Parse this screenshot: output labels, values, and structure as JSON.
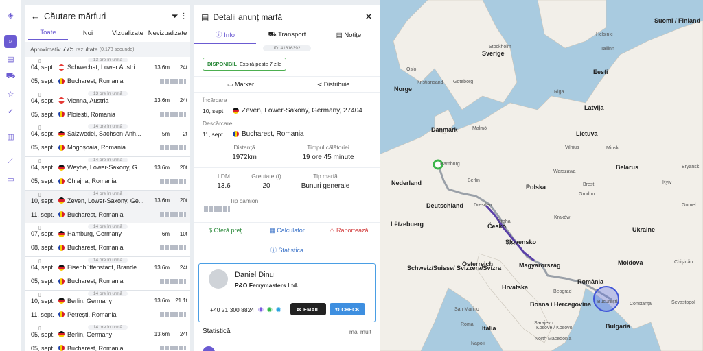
{
  "rail": {
    "items": [
      "logo-icon",
      "search-icon",
      "document-icon",
      "truck-icon",
      "star-icon",
      "check-icon",
      "book-icon",
      "chart-icon",
      "archive-icon"
    ]
  },
  "list": {
    "title": "Căutare mărfuri",
    "tabs": [
      "Toate",
      "Noi",
      "Vizualizate",
      "Nevizualizate"
    ],
    "approx_prefix": "Aproximativ",
    "approx_count": "775",
    "approx_suffix": "rezultate",
    "approx_time": "(0.178 secunde)",
    "cards": [
      {
        "ago": "13 ore în urmă",
        "d1": "04, sept.",
        "from": "Schwechat, Lower Austri...",
        "ldm": "13.6m",
        "w": "24t",
        "d2": "05, sept.",
        "to": "Bucharest, Romania",
        "f1": "at",
        "f2": "ro"
      },
      {
        "ago": "13 ore în urmă",
        "d1": "04, sept.",
        "from": "Vienna, Austria",
        "ldm": "13.6m",
        "w": "24t",
        "d2": "05, sept.",
        "to": "Ploiesti, Romania",
        "f1": "at",
        "f2": "ro"
      },
      {
        "ago": "14 ore în urmă",
        "d1": "04, sept.",
        "from": "Salzwedel, Sachsen-Anh...",
        "ldm": "5m",
        "w": "2t",
        "d2": "05, sept.",
        "to": "Mogoșoaia, Romania",
        "f1": "de",
        "f2": "ro"
      },
      {
        "ago": "14 ore în urmă",
        "d1": "04, sept.",
        "from": "Weyhe, Lower-Saxony, G...",
        "ldm": "13.6m",
        "w": "20t",
        "d2": "05, sept.",
        "to": "Chiajna, Romania",
        "f1": "de",
        "f2": "ro"
      },
      {
        "ago": "14 ore în urmă",
        "d1": "10, sept.",
        "from": "Zeven, Lower-Saxony, Ge...",
        "ldm": "13.6m",
        "w": "20t",
        "d2": "11, sept.",
        "to": "Bucharest, Romania",
        "f1": "de",
        "f2": "ro"
      },
      {
        "ago": "14 ore în urmă",
        "d1": "07, sept.",
        "from": "Hamburg, Germany",
        "ldm": "6m",
        "w": "10t",
        "d2": "08, sept.",
        "to": "Bucharest, Romania",
        "f1": "de",
        "f2": "ro"
      },
      {
        "ago": "14 ore în urmă",
        "d1": "04, sept.",
        "from": "Eisenhüttenstadt, Brande...",
        "ldm": "13.6m",
        "w": "24t",
        "d2": "05, sept.",
        "to": "Bucharest, Romania",
        "f1": "de",
        "f2": "ro"
      },
      {
        "ago": "14 ore în urmă",
        "d1": "10, sept.",
        "from": "Berlin, Germany",
        "ldm": "13.6m",
        "w": "21.1t",
        "d2": "11, sept.",
        "to": "Petrești, Romania",
        "f1": "de",
        "f2": "ro"
      },
      {
        "ago": "14 ore în urmă",
        "d1": "05, sept.",
        "from": "Berlin, Germany",
        "ldm": "13.6m",
        "w": "24t",
        "d2": "05, sept.",
        "to": "Bucharest, Romania",
        "f1": "de",
        "f2": "ro"
      }
    ]
  },
  "detail": {
    "title": "Detalii anunț marfă",
    "tabs": [
      "Info",
      "Transport",
      "Notițe"
    ],
    "id": "ID: 41616392",
    "avail": "DISPONIBIL",
    "expires": "Expiră peste 7 zile",
    "marker": "Marker",
    "share": "Distribuie",
    "load_label": "Încărcare",
    "load_date": "10, sept.",
    "load_place": "Zeven, Lower-Saxony, Germany, 27404",
    "unload_label": "Descărcare",
    "unload_date": "11, sept.",
    "unload_place": "Bucharest, Romania",
    "dist_label": "Distanță",
    "dist": "1972km",
    "time_label": "Timpul călătoriei",
    "time": "19 ore 45 minute",
    "ldm_label": "LDM",
    "ldm": "13.6",
    "wt_label": "Greutate (t)",
    "wt": "20",
    "type_label": "Tip marfă",
    "type": "Bunuri generale",
    "truck_label": "Tip camion",
    "offer": "Oferă preț",
    "calc": "Calculator",
    "report": "Raportează",
    "stats_link": "Statistica",
    "contact": {
      "name": "Daniel Dinu",
      "company": "P&O Ferrymasters Ltd.",
      "phone": "+40 21 300 8824",
      "email": "EMAIL",
      "check": "CHECK"
    },
    "stats_title": "Statistică",
    "more": "mai mult"
  },
  "map": {
    "labels": [
      [
        "Sverige",
        "b"
      ],
      [
        "Suomi / Finland",
        "b"
      ],
      [
        "Norge",
        "b"
      ],
      [
        "Eesti",
        "b"
      ],
      [
        "Latvija",
        "b"
      ],
      [
        "Lietuva",
        "b"
      ],
      [
        "Danmark",
        "b"
      ],
      [
        "Belarus",
        "b"
      ],
      [
        "Polska",
        "b"
      ],
      [
        "Nederland",
        "b"
      ],
      [
        "Deutschland",
        "b"
      ],
      [
        "Česko",
        "b"
      ],
      [
        "Slovensko",
        "b"
      ],
      [
        "Magyarország",
        "b"
      ],
      [
        "România",
        "b"
      ],
      [
        "Moldova",
        "b"
      ],
      [
        "Ukraine",
        "b"
      ],
      [
        "Österreich",
        "b"
      ],
      [
        "Hrvatska",
        "b"
      ],
      [
        "Bulgaria",
        "b"
      ],
      [
        "Italia",
        "b"
      ],
      [
        "Bosna i Hercegovina",
        "b"
      ],
      [
        "Schweiz/Suisse/ Svizzera/Svizra",
        "b"
      ],
      [
        "Lëtzebuerg",
        "b"
      ],
      [
        "Stockholm",
        ""
      ],
      [
        "Oslo",
        ""
      ],
      [
        "Helsinki",
        ""
      ],
      [
        "Tallinn",
        ""
      ],
      [
        "Riga",
        ""
      ],
      [
        "Vilnius",
        ""
      ],
      [
        "Minsk",
        ""
      ],
      [
        "Warszawa",
        ""
      ],
      [
        "Berlin",
        ""
      ],
      [
        "Hamburg",
        ""
      ],
      [
        "Dresden",
        ""
      ],
      [
        "Wien",
        ""
      ],
      [
        "Praha",
        ""
      ],
      [
        "Kraków",
        ""
      ],
      [
        "Kyiv",
        ""
      ],
      [
        "Chișinău",
        ""
      ],
      [
        "Constanța",
        ""
      ],
      [
        "Sevastopol",
        ""
      ],
      [
        "București",
        ""
      ],
      [
        "Beograd",
        ""
      ],
      [
        "Sarajevo",
        ""
      ],
      [
        "Roma",
        ""
      ],
      [
        "Napoli",
        ""
      ],
      [
        "San Marino",
        ""
      ],
      [
        "Kosovë / Kosovo",
        ""
      ],
      [
        "North Macedonia",
        ""
      ],
      [
        "Malmö",
        ""
      ],
      [
        "Göteborg",
        ""
      ],
      [
        "Kristiansand",
        ""
      ],
      [
        "Brest",
        ""
      ],
      [
        "Grodno",
        ""
      ],
      [
        "Bryansk",
        ""
      ],
      [
        "Gomel",
        ""
      ]
    ]
  }
}
